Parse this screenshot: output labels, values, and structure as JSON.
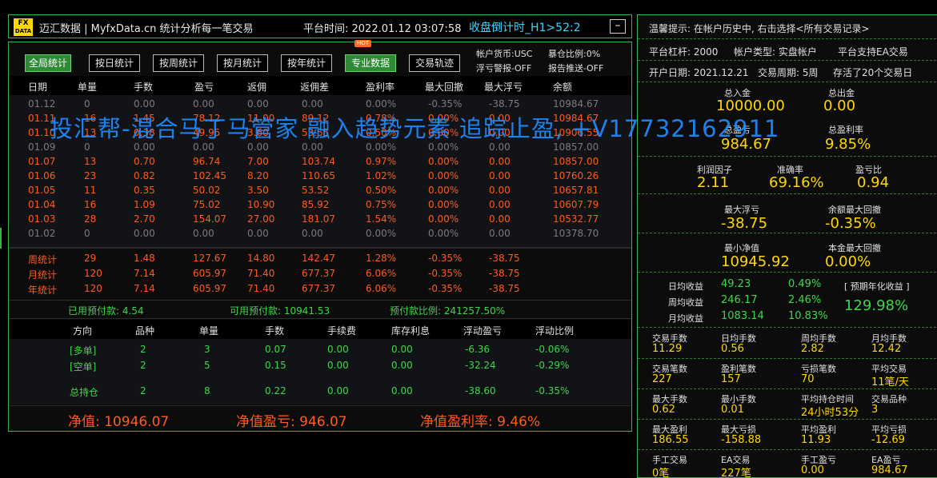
{
  "topbar": {
    "logo_top": "FX",
    "logo_bottom": "DATA",
    "title": "迈汇数据 | MyfxData.cn  统计分析每一笔交易",
    "platform_time": "平台时间: 2022.01.12 03:07:58",
    "countdown": "收盘倒计时_H1>52:2",
    "minimize_label": "–"
  },
  "buttons": [
    {
      "label": "全局统计",
      "active": true
    },
    {
      "label": "按日统计",
      "active": false
    },
    {
      "label": "按周统计",
      "active": false
    },
    {
      "label": "按月统计",
      "active": false
    },
    {
      "label": "按年统计",
      "active": false
    },
    {
      "label": "专业数据",
      "active": true
    },
    {
      "label": "交易轨迹",
      "active": false
    }
  ],
  "hot_badge": "HOT",
  "account_info": {
    "currency": "帐户货币:USC",
    "float_alert": "浮亏警报-OFF",
    "leverage_ratio": "暴仓比例:0%",
    "report_push": "报告推送-OFF"
  },
  "table_headers": [
    "日期",
    "单量",
    "手数",
    "盈亏",
    "返佣",
    "返佣差",
    "盈利率",
    "最大回撤",
    "最大浮亏",
    "余额"
  ],
  "daily_rows": [
    {
      "style": "gray",
      "cells": [
        "01.12",
        "0",
        "0.00",
        "0.00",
        "0.00",
        "0.00",
        "0.00%",
        "-0.35%",
        "-38.75",
        "10984.67"
      ]
    },
    {
      "style": "red",
      "cells": [
        "01.11",
        "16",
        "1.45",
        "78.12",
        "11.00",
        "89.12",
        "0.78%",
        "0.00%",
        "0.00",
        "10984.67"
      ]
    },
    {
      "style": "red",
      "cells": [
        "01.10",
        "13",
        "0.38",
        "49.95",
        "3.60",
        "53.55",
        "0.50%",
        "0.00%",
        "0.00",
        "10906.55"
      ]
    },
    {
      "style": "gray",
      "cells": [
        "01.09",
        "0",
        "0.00",
        "0.00",
        "0.00",
        "0.00",
        "0.00%",
        "0.00%",
        "0.00",
        "10857.00"
      ]
    },
    {
      "style": "red",
      "cells": [
        "01.07",
        "13",
        "0.70",
        "96.74",
        "7.00",
        "103.74",
        "0.97%",
        "0.00%",
        "0.00",
        "10857.00"
      ]
    },
    {
      "style": "red",
      "cells": [
        "01.06",
        "23",
        "0.82",
        "102.45",
        "8.20",
        "110.65",
        "1.02%",
        "0.00%",
        "0.00",
        "10760.26"
      ]
    },
    {
      "style": "red",
      "cells": [
        "01.05",
        "11",
        "0.35",
        "50.02",
        "3.50",
        "53.52",
        "0.50%",
        "0.00%",
        "0.00",
        "10657.81"
      ]
    },
    {
      "style": "red",
      "cells": [
        "01.04",
        "16",
        "1.09",
        "75.02",
        "10.90",
        "85.92",
        "0.75%",
        "0.00%",
        "0.00",
        "10607.79"
      ]
    },
    {
      "style": "red",
      "cells": [
        "01.03",
        "28",
        "2.70",
        "154.07",
        "27.00",
        "181.07",
        "1.54%",
        "0.00%",
        "0.00",
        "10532.77"
      ]
    },
    {
      "style": "gray",
      "cells": [
        "01.02",
        "0",
        "0.00",
        "0.00",
        "0.00",
        "0.00",
        "0.00%",
        "0.00%",
        "0.00",
        "10378.70"
      ]
    }
  ],
  "summary_rows": [
    {
      "cells": [
        "周统计",
        "29",
        "1.48",
        "127.67",
        "14.80",
        "142.47",
        "1.28%",
        "-0.35%",
        "-38.75"
      ]
    },
    {
      "cells": [
        "月统计",
        "120",
        "7.14",
        "605.97",
        "71.40",
        "677.37",
        "6.06%",
        "-0.35%",
        "-38.75"
      ]
    },
    {
      "cells": [
        "年统计",
        "120",
        "7.14",
        "605.97",
        "71.40",
        "677.37",
        "6.06%",
        "-0.35%",
        "-38.75"
      ]
    }
  ],
  "prepay": {
    "used": "已用预付款: 4.54",
    "available": "可用预付款: 10941.53",
    "ratio": "预付款比例: 241257.50%"
  },
  "position_headers": [
    "方向",
    "品种",
    "单量",
    "手数",
    "手续费",
    "库存利息",
    "浮动盈亏",
    "浮动比例"
  ],
  "position_rows": [
    {
      "cells": [
        "[多单]",
        "2",
        "3",
        "0.07",
        "0.00",
        "0.00",
        "-6.36",
        "-0.06%"
      ]
    },
    {
      "cells": [
        "[空单]",
        "2",
        "5",
        "0.15",
        "0.00",
        "0.00",
        "-32.24",
        "-0.29%"
      ]
    },
    {
      "cells": [
        "总持仓",
        "2",
        "8",
        "0.22",
        "0.00",
        "0.00",
        "-38.60",
        "-0.35%"
      ]
    }
  ],
  "net": {
    "equity": "净值:  10946.07",
    "equity_pl": "净值盈亏:  946.07",
    "equity_rate": "净值盈利率:  9.46%"
  },
  "watermark": "投汇帮-混合马丁马管家  融入趋势元素  追踪止盈,  +V17732162911",
  "right": {
    "tip": "温馨提示: 在帐户历史中, 右击选择<所有交易记录>",
    "leverage": "平台杠杆:  2000",
    "account_type": "帐户类型:  实盘帐户",
    "ea_support": "平台支持EA交易",
    "open_date": "开户日期:  2021.12.21",
    "cycle": "交易周期:  5周",
    "survived": "存活了20个交易日",
    "total_deposit_label": "总入金",
    "total_deposit": "10000.00",
    "total_withdraw_label": "总出金",
    "total_withdraw": "0.00",
    "total_profit_label": "总盈亏",
    "total_profit": "984.67",
    "total_rate_label": "总盈利率",
    "total_rate": "9.85%",
    "profit_factor_label": "利润因子",
    "profit_factor": "2.11",
    "accuracy_label": "准确率",
    "accuracy": "69.16%",
    "pl_ratio_label": "盈亏比",
    "pl_ratio": "0.94",
    "max_float_label": "最大浮亏",
    "max_float": "-38.75",
    "max_balance_dd_label": "余额最大回撤",
    "max_balance_dd": "-0.35%",
    "min_equity_label": "最小净值",
    "min_equity": "10945.92",
    "max_principal_dd_label": "本金最大回撤",
    "max_principal_dd": "0.00%",
    "daily_avg_label": "日均收益",
    "daily_avg": "49.23",
    "daily_avg_rate": "0.49%",
    "weekly_avg_label": "周均收益",
    "weekly_avg": "246.17",
    "weekly_avg_rate": "2.46%",
    "monthly_avg_label": "月均收益",
    "monthly_avg": "1083.14",
    "monthly_avg_rate": "10.83%",
    "annual_label": "[ 预期年化收益 ]",
    "annual": "129.98%",
    "grid": [
      [
        {
          "l": "交易手数",
          "v": "11.29"
        },
        {
          "l": "日均手数",
          "v": "0.56"
        },
        {
          "l": "周均手数",
          "v": "2.82"
        },
        {
          "l": "月均手数",
          "v": "12.42"
        }
      ],
      [
        {
          "l": "交易笔数",
          "v": "227"
        },
        {
          "l": "盈利笔数",
          "v": "157"
        },
        {
          "l": "亏损笔数",
          "v": "70"
        },
        {
          "l": "平均交易",
          "v": "11笔/天"
        }
      ],
      [
        {
          "l": "最大手数",
          "v": "0.62"
        },
        {
          "l": "最小手数",
          "v": "0.01"
        },
        {
          "l": "平均持仓时间",
          "v": "24小时53分"
        },
        {
          "l": "交易品种",
          "v": "3"
        }
      ],
      [
        {
          "l": "最大盈利",
          "v": "186.55"
        },
        {
          "l": "最大亏损",
          "v": "-158.88"
        },
        {
          "l": "平均盈利",
          "v": "11.93"
        },
        {
          "l": "平均亏损",
          "v": "-12.69"
        }
      ],
      [
        {
          "l": "手工交易",
          "v": "0笔"
        },
        {
          "l": "EA交易",
          "v": "227笔"
        },
        {
          "l": "手工盈亏",
          "v": "0.00"
        },
        {
          "l": "EA盈亏",
          "v": "984.67"
        }
      ]
    ]
  },
  "colors": {
    "accent_green": "#3bb54a",
    "loss_red": "#ff5a1f",
    "value_yellow": "#ffd800",
    "countdown_cyan": "#3cd4ff"
  }
}
